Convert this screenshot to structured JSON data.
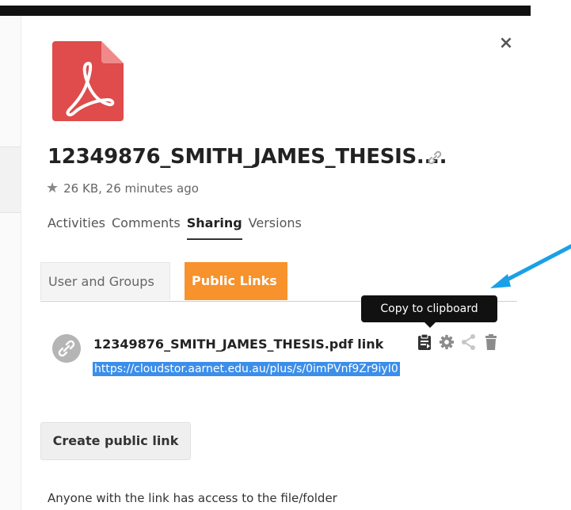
{
  "header": {
    "close_label": "×"
  },
  "file": {
    "name": "12349876_SMITH_JAMES_THESIS....",
    "meta": "26 KB, 26 minutes ago",
    "icon_color": "#e04b4b"
  },
  "detail_tabs": [
    {
      "label": "Activities"
    },
    {
      "label": "Comments"
    },
    {
      "label": "Sharing"
    },
    {
      "label": "Versions"
    }
  ],
  "sharing_tabs": {
    "users": "User and Groups",
    "public": "Public Links",
    "accent_color": "#f7922c"
  },
  "tooltip": {
    "text": "Copy to clipboard"
  },
  "public_link": {
    "name": "12349876_SMITH_JAMES_THESIS.pdf link",
    "url": "https://cloudstor.aarnet.edu.au/plus/s/0imPVnf9Zr9iyI0",
    "actions": [
      "clipboard-icon",
      "gear-icon",
      "share-icon",
      "trash-icon"
    ]
  },
  "create_button": {
    "label": "Create public link"
  },
  "note": {
    "text": "Anyone with the link has access to the file/folder"
  },
  "annotation": {
    "arrow_color": "#1aa0e6"
  }
}
